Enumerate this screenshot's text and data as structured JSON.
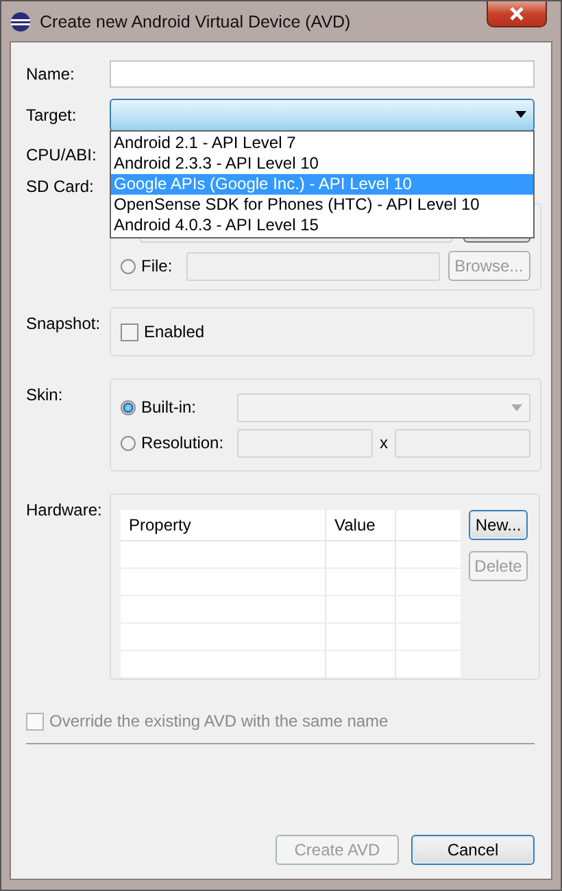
{
  "window": {
    "title": "Create new Android Virtual Device (AVD)"
  },
  "name": {
    "label": "Name:"
  },
  "target": {
    "label": "Target:",
    "options": [
      {
        "label": "Android 2.1 - API Level 7",
        "selected": false
      },
      {
        "label": "Android 2.3.3 - API Level 10",
        "selected": false
      },
      {
        "label": "Google APIs (Google Inc.) - API Level 10",
        "selected": true
      },
      {
        "label": "OpenSense SDK for Phones (HTC) - API Level 10",
        "selected": false
      },
      {
        "label": "Android 4.0.3 - API Level 15",
        "selected": false
      }
    ]
  },
  "cpu_abi": {
    "label": "CPU/ABI:"
  },
  "sd_card": {
    "label": "SD Card:",
    "file": {
      "label": "File:",
      "selected": false
    },
    "browse": {
      "label": "Browse...",
      "disabled": true
    }
  },
  "snapshot": {
    "label": "Snapshot:",
    "enabled": {
      "label": "Enabled",
      "checked": false
    }
  },
  "skin": {
    "label": "Skin:",
    "options": [
      {
        "label": "Built-in:",
        "selected": true,
        "kind": "dropdown"
      },
      {
        "label": "Resolution:",
        "selected": false,
        "kind": "size",
        "separator": "x"
      }
    ]
  },
  "hardware": {
    "label": "Hardware:",
    "columns": [
      "Property",
      "Value"
    ],
    "buttons": [
      {
        "label": "New...",
        "disabled": false
      },
      {
        "label": "Delete",
        "disabled": true
      }
    ]
  },
  "override": {
    "label": "Override the existing AVD with the same name",
    "checked": false,
    "disabled": true
  },
  "buttons": [
    {
      "label": "Create AVD",
      "disabled": true
    },
    {
      "label": "Cancel",
      "disabled": false
    }
  ]
}
